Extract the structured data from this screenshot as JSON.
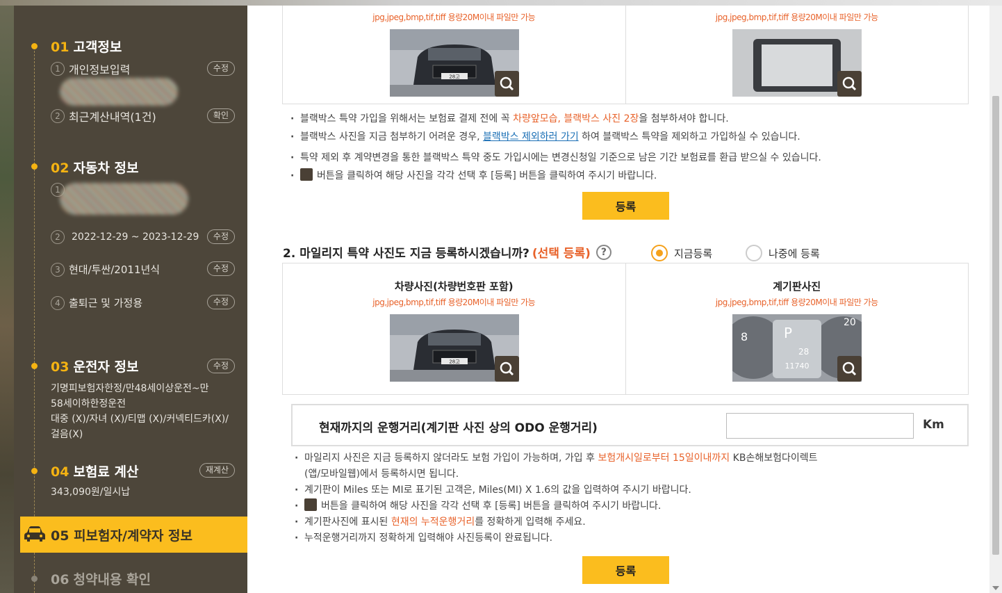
{
  "sidebar": {
    "step1": {
      "num": "01",
      "title": "고객정보",
      "sub1": {
        "num": "1",
        "label": "개인정보입력",
        "button": "수정"
      },
      "sub2": {
        "num": "2",
        "label": "최근계산내역(1건)",
        "button": "확인"
      }
    },
    "step2": {
      "num": "02",
      "title": "자동차 정보",
      "sub1": {
        "num": "1"
      },
      "sub2": {
        "num": "2",
        "label": "2022-12-29 ~ 2023-12-29",
        "button": "수정"
      },
      "sub3": {
        "num": "3",
        "label": "현대/투싼/2011년식",
        "button": "수정"
      },
      "sub4": {
        "num": "4",
        "label": "출퇴근 및 가정용",
        "button": "수정"
      }
    },
    "step3": {
      "num": "03",
      "title": "운전자 정보",
      "button": "수정",
      "line1": "기명피보험자한정/만48세이상운전~만",
      "line2": "58세이하한정운전",
      "line3": "대중 (X)/자녀 (X)/티맵 (X)/커넥티드카(X)/",
      "line4": "걸음(X)"
    },
    "step4": {
      "num": "04",
      "title": "보험료 계산",
      "button": "재계산",
      "amount": "343,090원/일시납"
    },
    "step5": {
      "num": "05",
      "title": "피보험자/계약자 정보"
    },
    "step6": {
      "num": "06",
      "title": "청약내용 확인"
    }
  },
  "blackbox": {
    "hint_left": "jpg,jpeg,bmp,tif,tiff 용량20M이내 파일만 가능",
    "hint_right": "jpg,jpeg,bmp,tif,tiff 용량20M이내 파일만 가능",
    "plate": "28고",
    "notes": {
      "n1_a": "블랙박스 특약 가입을 위해서는 보험료 결제 전에 꼭 ",
      "n1_hl": "차량앞모습, 블랙박스 사진 2장",
      "n1_b": "을 첨부하셔야 합니다.",
      "n2_a": "블랙박스 사진을 지금 첨부하기 어려운 경우, ",
      "n2_link": "블랙박스 제외하러 가기",
      "n2_b": " 하여 블랙박스 특약을 제외하고 가입하실 수 있습니다.",
      "n3": "특약 제외 후 계약변경을 통한 블랙박스 특약 중도 가입시에는 변경신청일 기준으로 남은 기간 보험료를 환급 받으실 수 있습니다.",
      "n4": "버튼을 클릭하여 해당 사진을 각각 선택 후 [등록] 버튼을 클릭하여 주시기 바랍니다."
    },
    "register": "등록"
  },
  "mileage": {
    "question": "2. 마일리지 특약 사진도 지금 등록하시겠습니까?",
    "optional": "(선택 등록)",
    "help": "?",
    "radio_now": "지금등록",
    "radio_later": "나중에 등록",
    "col_left_title": "차량사진(차량번호판 포함)",
    "col_left_hint": "jpg,jpeg,bmp,tif,tiff 용량20M이내 파일만 가능",
    "col_right_title": "계기판사진",
    "col_right_hint": "jpg,jpeg,bmp,tif,tiff 용량20M이내 파일만 가능",
    "plate": "28고",
    "dash_p": "P",
    "dash_num": "28",
    "dash_odo": "11740",
    "odo_label": "현재까지의 운행거리(계기판 사진 상의 ODO 운행거리)",
    "odo_value": "",
    "odo_unit": "Km",
    "notes": {
      "n1_a": "마일리지 사진은 지금 등록하지 않더라도 보험 가입이 가능하며, 가입 후 ",
      "n1_hl": "보험개시일로부터 15일이내까지",
      "n1_b": " KB손해보험다이렉트",
      "n1_c": "(앱/모바일웹)에서 등록하시면 됩니다.",
      "n2": "계기판이 Miles 또는 MI로 표기된 고객은, Miles(MI) X 1.6의 값을 입력하여 주시기 바랍니다.",
      "n3": "버튼을 클릭하여 해당 사진을 각각 선택 후 [등록] 버튼을 클릭하여 주시기 바랍니다.",
      "n4_a": "계기판사진에 표시된 ",
      "n4_hl": "현재의 누적운행거리",
      "n4_b": "를 정확하게 입력해 주세요.",
      "n5": "누적운행거리까지 정확하게 입력해야 사진등록이 완료됩니다."
    },
    "register": "등록"
  }
}
